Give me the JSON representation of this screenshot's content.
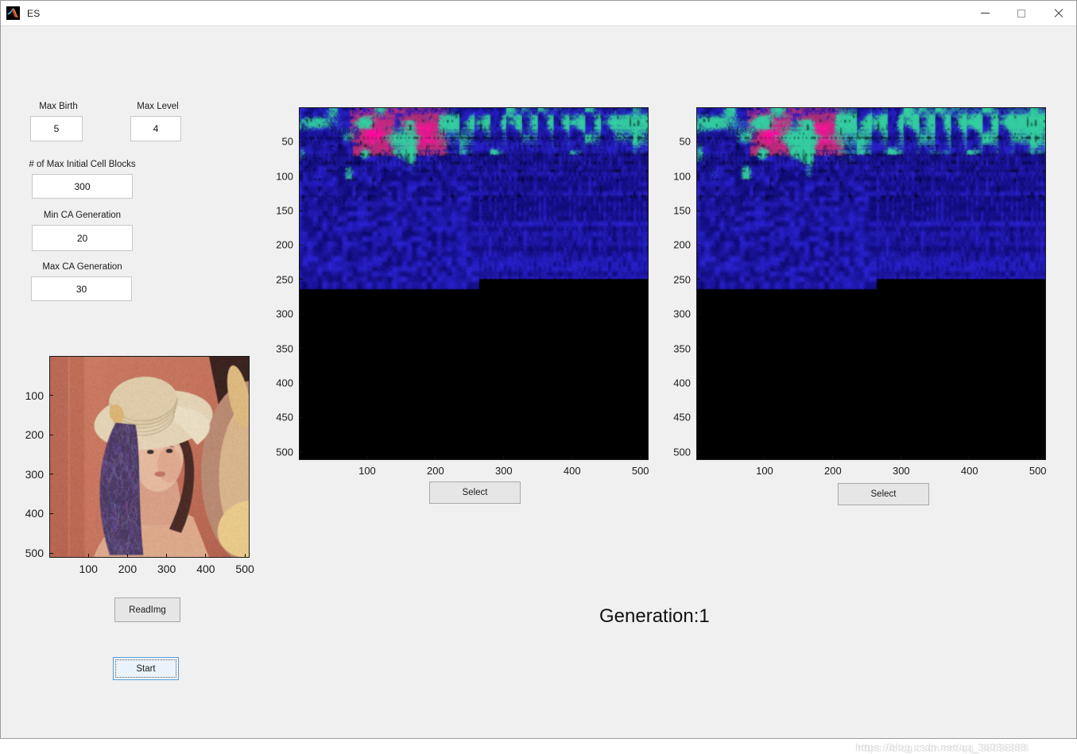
{
  "window": {
    "title": "ES",
    "icon": "matlab-logo-icon",
    "controls": {
      "minimize": "minimize-icon",
      "maximize": "maximize-icon",
      "close": "close-icon"
    }
  },
  "parameters": {
    "fields": [
      {
        "label": "Max Birth",
        "value": "5"
      },
      {
        "label": "Max Level",
        "value": "4"
      },
      {
        "label": "# of Max Initial Cell Blocks",
        "value": "300"
      },
      {
        "label": "Min CA Generation",
        "value": "20"
      },
      {
        "label": "Max CA Generation",
        "value": "30"
      }
    ]
  },
  "buttons": {
    "read_img": "ReadImg",
    "start": "Start",
    "select_left": "Select",
    "select_right": "Select"
  },
  "status": {
    "generation_label": "Generation:1"
  },
  "axes": {
    "source": {
      "name": "source-image-axes",
      "image": "lena-test-image",
      "xticks": [
        "100",
        "200",
        "300",
        "400",
        "500"
      ],
      "yticks": [
        "100",
        "200",
        "300",
        "400",
        "500"
      ],
      "xlim": [
        0,
        512
      ],
      "ylim": [
        0,
        512
      ]
    },
    "result_left": {
      "name": "ca-result-axes-left",
      "image": "cellular-automata-output-left",
      "xticks": [
        "100",
        "200",
        "300",
        "400",
        "500"
      ],
      "yticks": [
        "50",
        "100",
        "150",
        "200",
        "250",
        "300",
        "350",
        "400",
        "450",
        "500"
      ],
      "xlim": [
        0,
        512
      ],
      "ylim": [
        0,
        512
      ]
    },
    "result_right": {
      "name": "ca-result-axes-right",
      "image": "cellular-automata-output-right",
      "xticks": [
        "100",
        "200",
        "300",
        "400",
        "500"
      ],
      "yticks": [
        "50",
        "100",
        "150",
        "200",
        "250",
        "300",
        "350",
        "400",
        "450",
        "500"
      ],
      "xlim": [
        0,
        512
      ],
      "ylim": [
        0,
        512
      ]
    }
  },
  "watermark": {
    "text": "https://blog.csdn.net/qq_36036888"
  },
  "colors": {
    "window_background": "#f0f0f0",
    "titlebar": "#ffffff",
    "edit_background": "#ffffff",
    "button_face": "#e6e6e6",
    "focus_blue": "#4d9ad6",
    "text": "#1b1b1b",
    "ca_magenta": "#ff1a8c",
    "ca_blue": "#1c1ca0",
    "ca_teal": "#30c9a0"
  }
}
